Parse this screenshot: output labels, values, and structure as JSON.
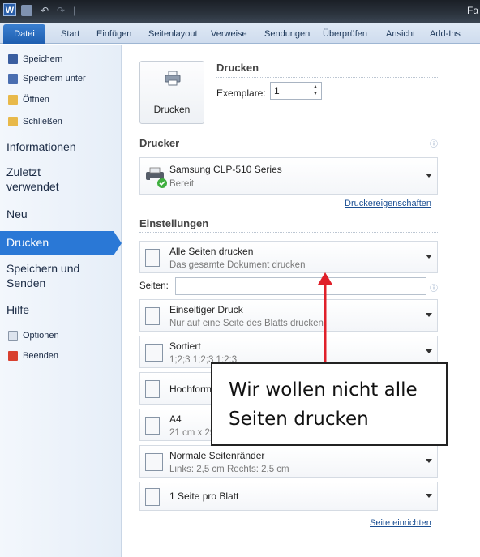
{
  "titlebar": {
    "app_icon": "W",
    "title": "Fa"
  },
  "tabs": [
    "Datei",
    "Start",
    "Einfügen",
    "Seitenlayout",
    "Verweise",
    "Sendungen",
    "Überprüfen",
    "Ansicht",
    "Add-Ins"
  ],
  "nav": {
    "speichern": "Speichern",
    "speichern_unter": "Speichern unter",
    "oeffnen": "Öffnen",
    "schliessen": "Schließen",
    "informationen": "Informationen",
    "zuletzt_1": "Zuletzt",
    "zuletzt_2": "verwendet",
    "neu": "Neu",
    "drucken": "Drucken",
    "speichern_senden_1": "Speichern und",
    "speichern_senden_2": "Senden",
    "hilfe": "Hilfe",
    "optionen": "Optionen",
    "beenden": "Beenden"
  },
  "print": {
    "heading": "Drucken",
    "button_label": "Drucken",
    "copies_label": "Exemplare:",
    "copies_value": "1",
    "printer_heading": "Drucker",
    "printer_name": "Samsung CLP-510 Series",
    "printer_status": "Bereit",
    "printer_properties_link": "Druckereigenschaften",
    "settings_heading": "Einstellungen",
    "pages_label": "Seiten:",
    "page_setup_link": "Seite einrichten",
    "settings": [
      {
        "title": "Alle Seiten drucken",
        "subtitle": "Das gesamte Dokument drucken"
      },
      {
        "title": "Einseitiger Druck",
        "subtitle": "Nur auf eine Seite des Blatts drucken"
      },
      {
        "title": "Sortiert",
        "subtitle": "1;2;3    1;2;3    1;2;3"
      },
      {
        "title": "Hochformat",
        "subtitle": ""
      },
      {
        "title": "A4",
        "subtitle": "21 cm x 29,7 cm"
      },
      {
        "title": "Normale Seitenränder",
        "subtitle": "Links: 2,5 cm    Rechts: 2,5 cm"
      },
      {
        "title": "1 Seite pro Blatt",
        "subtitle": ""
      }
    ]
  },
  "annotation": {
    "line1": "Wir wollen nicht alle",
    "line2": "Seiten drucken"
  },
  "colors": {
    "accent": "#2a78d6",
    "arrow": "#e0202a"
  }
}
